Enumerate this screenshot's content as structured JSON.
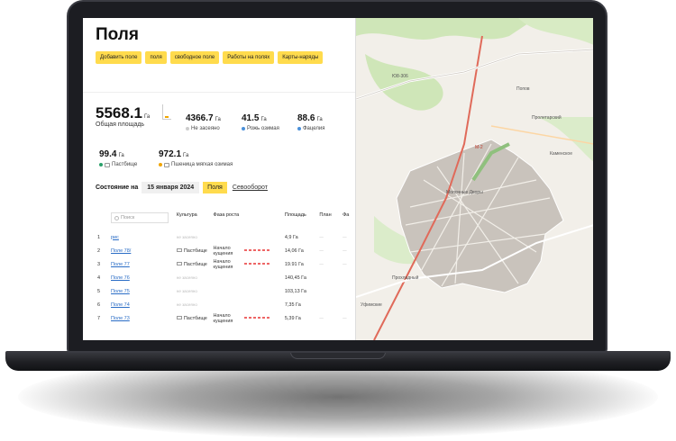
{
  "page": {
    "title": "Поля",
    "buttons": [
      "Добавить поле",
      "поля",
      "свободное поле",
      "Работы на полях",
      "Карты-наряды"
    ]
  },
  "summary": {
    "total": {
      "value": "5568.1",
      "unit": "Га",
      "label": "Общая площадь"
    },
    "stats": [
      {
        "value": "4366.7",
        "unit": "Га",
        "label": "Не засеяно",
        "color": "#cccccc"
      },
      {
        "value": "41.5",
        "unit": "Га",
        "label": "Рожь озимая",
        "color": "#4a90d9"
      },
      {
        "value": "88.6",
        "unit": "Га",
        "label": "Фацелия",
        "color": "#4a90d9"
      },
      {
        "value": "99.4",
        "unit": "Га",
        "label": "Пастбище",
        "color": "#2aa06a"
      },
      {
        "value": "972.1",
        "unit": "Га",
        "label": "Пшеница мягкая озимая",
        "color": "#f0a500"
      }
    ]
  },
  "state": {
    "label": "Состояние на",
    "date": "15 января 2024",
    "fields_tab": "Поля",
    "rotation_link": "Севооборот"
  },
  "table": {
    "search_placeholder": "Поиск",
    "headers": [
      "Культура",
      "Фаза роста",
      "Площадь",
      "План",
      "Фа"
    ],
    "rows": [
      {
        "n": "1",
        "name": "рис",
        "crop": "не засеяно",
        "phase": "",
        "area": "4,9 Га"
      },
      {
        "n": "2",
        "name": "Поле 78/",
        "crop": "Пастбище",
        "phase": "Начало кущения",
        "area": "14,06 Га"
      },
      {
        "n": "3",
        "name": "Поле 77",
        "crop": "Пастбище",
        "phase": "Начало кущения",
        "area": "19.91 Га"
      },
      {
        "n": "4",
        "name": "Поле 76",
        "crop": "не засеяно",
        "phase": "",
        "area": "140,45 Га"
      },
      {
        "n": "5",
        "name": "Поле 75",
        "crop": "не засеяно",
        "phase": "",
        "area": "103,13 Га"
      },
      {
        "n": "6",
        "name": "Поле 74",
        "crop": "не засеяно",
        "phase": "",
        "area": "7,35 Га"
      },
      {
        "n": "7",
        "name": "Поле 73",
        "crop": "Пастбище",
        "phase": "Начало кущения",
        "area": "5,39 Га"
      }
    ]
  },
  "map": {
    "labels": [
      "Попов",
      "Пролетарский",
      "Каменское",
      "Молочные Дворы",
      "Прохладный",
      "Уфимские",
      "М-2",
      "Ю8-306"
    ]
  }
}
